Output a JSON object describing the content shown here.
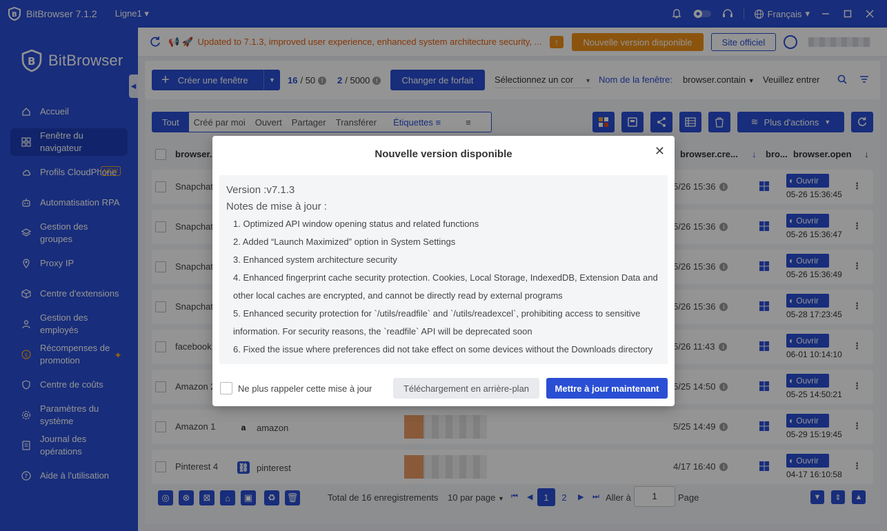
{
  "titlebar": {
    "app_title": "BitBrowser 7.1.2",
    "line_selector": "Ligne1",
    "language": "Français"
  },
  "sidebar": {
    "brand": "BitBrowser",
    "items": [
      {
        "label": "Accueil",
        "icon": "home-icon"
      },
      {
        "label": "Fenêtre du navigateur",
        "icon": "grid-icon",
        "active": true
      },
      {
        "label": "Profils CloudPhone",
        "icon": "cloud-icon",
        "badge": "NEW"
      },
      {
        "label": "Automatisation RPA",
        "icon": "robot-icon"
      },
      {
        "label": "Gestion des groupes",
        "icon": "layers-icon"
      },
      {
        "label": "Proxy IP",
        "icon": "location-icon"
      },
      {
        "label": "Centre d'extensions",
        "icon": "cube-icon"
      },
      {
        "label": "Gestion des employés",
        "icon": "users-icon"
      },
      {
        "label": "Récompenses de promotion",
        "icon": "coin-icon"
      },
      {
        "label": "Centre de coûts",
        "icon": "shield-icon"
      },
      {
        "label": "Paramètres du système",
        "icon": "settings-icon"
      },
      {
        "label": "Journal des opérations",
        "icon": "log-icon"
      },
      {
        "label": "Aide à l'utilisation",
        "icon": "help-icon"
      }
    ]
  },
  "banner": {
    "message": "Updated to 7.1.3, improved user experience, enhanced system architecture security, ...",
    "new_version_button": "Nouvelle version disponible",
    "site_button": "Site officiel"
  },
  "toolbar": {
    "create_button": "Créer une fenêtre",
    "windows_used": "16",
    "windows_total": "/ 50",
    "opens_used": "2",
    "opens_total": "/ 5000",
    "plan_button": "Changer de forfait",
    "group_select_placeholder": "Sélectionnez un cor",
    "name_filter_label": "Nom de la fenêtre:",
    "name_filter_field": "browser.contain",
    "name_input_placeholder": "Veuillez entrer"
  },
  "tabs": [
    "Tout",
    "Créé par moi",
    "Ouvert",
    "Partager",
    "Transférer"
  ],
  "tags_label": "Étiquettes",
  "more_actions": "Plus d'actions",
  "table": {
    "headers": {
      "name": "browser..",
      "created": "browser.cre...",
      "os": "bro...",
      "open": "browser.open"
    },
    "rows": [
      {
        "name": "Snapchat",
        "platform": "",
        "created": "5/26 15:36",
        "open_label": "Ouvrir",
        "open_time": "05-26 15:36:45"
      },
      {
        "name": "Snapchat",
        "platform": "",
        "created": "5/26 15:36",
        "open_label": "Ouvrir",
        "open_time": "05-26 15:36:47"
      },
      {
        "name": "Snapchat",
        "platform": "",
        "created": "5/26 15:36",
        "open_label": "Ouvrir",
        "open_time": "05-26 15:36:49"
      },
      {
        "name": "Snapchat",
        "platform": "",
        "created": "5/26 15:36",
        "open_label": "Ouvrir",
        "open_time": "05-28 17:23:45"
      },
      {
        "name": "facebook",
        "platform": "",
        "created": "5/26 11:43",
        "open_label": "Ouvrir",
        "open_time": "06-01 10:14:10"
      },
      {
        "name": "Amazon 2",
        "platform": "",
        "created": "5/25 14:50",
        "open_label": "Ouvrir",
        "open_time": "05-25 14:50:21"
      },
      {
        "name": "Amazon 1",
        "platform": "amazon",
        "created": "5/25 14:49",
        "open_label": "Ouvrir",
        "open_time": "05-29 15:19:45"
      },
      {
        "name": "Pinterest 4",
        "platform": "pinterest",
        "created": "4/17 16:40",
        "open_label": "Ouvrir",
        "open_time": "04-17 16:10:58"
      }
    ]
  },
  "footer": {
    "total": "Total de 16 enregistrements",
    "per_page": "10 par page",
    "pages": [
      "1",
      "2"
    ],
    "goto_label": "Aller à",
    "goto_value": "1",
    "page_label": "Page"
  },
  "modal": {
    "title": "Nouvelle version disponible",
    "version": "Version :v7.1.3",
    "notes_title": "Notes de mise à jour :",
    "notes": [
      "1. Optimized API window opening status and related functions",
      "2. Added “Launch Maximized” option in System Settings",
      "3. Enhanced system architecture security",
      "4. Enhanced fingerprint cache security protection. Cookies, Local Storage, IndexedDB, Extension Data and other local caches are encrypted, and cannot be directly read by external programs",
      "5. Enhanced security protection for `/utils/readfile` and `/utils/readexcel`, prohibiting access to sensitive information. For security reasons, the `readfile` API will be deprecated soon",
      "6. Fixed the issue where preferences did not take effect on some devices without the Downloads directory"
    ],
    "remind_label": "Ne plus rappeler cette mise à jour",
    "background_button": "Téléchargement en arrière-plan",
    "update_now_button": "Mettre à jour maintenant"
  },
  "colors": {
    "primary": "#2a4fd4",
    "warning": "#f09219",
    "banner_text": "#e6610f"
  }
}
